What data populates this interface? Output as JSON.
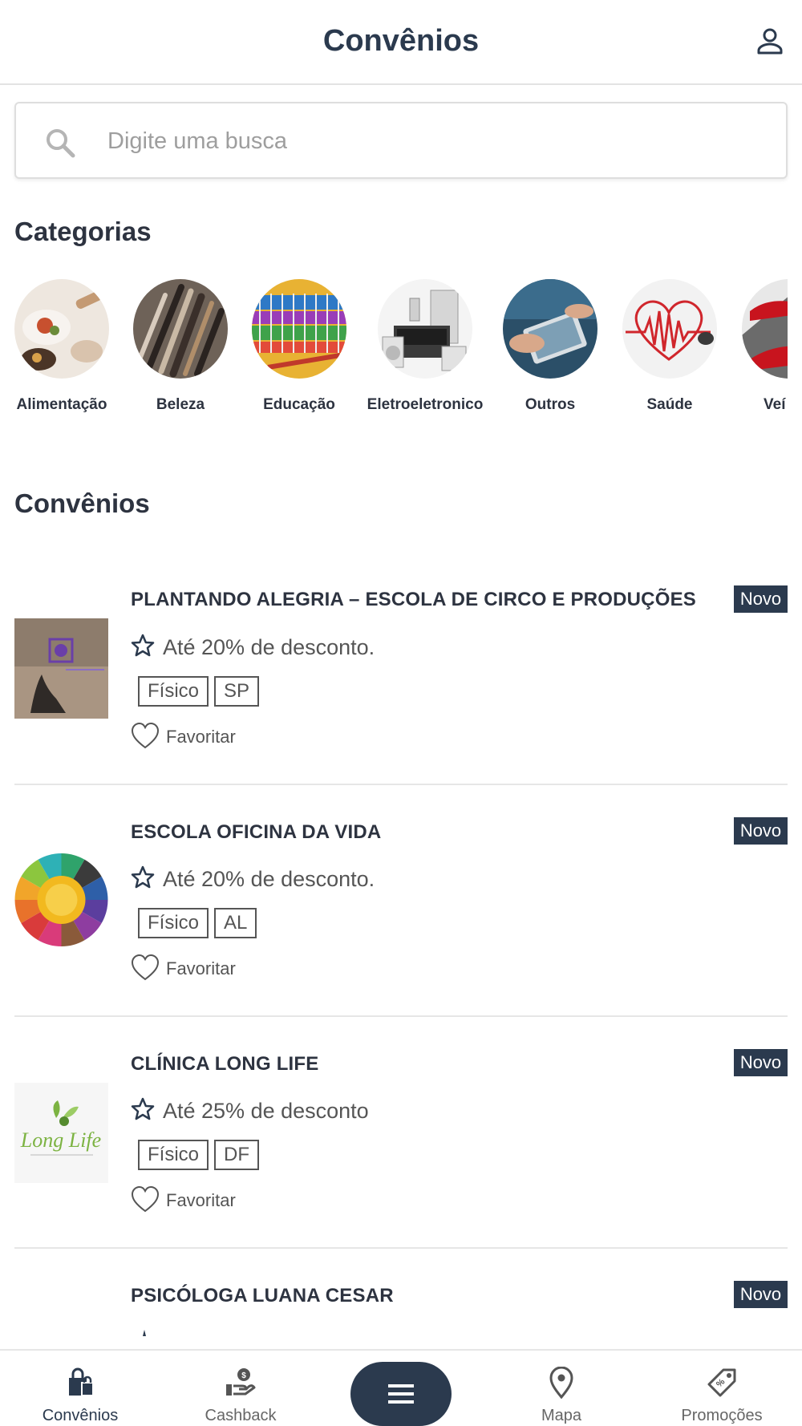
{
  "header": {
    "title": "Convênios",
    "profile_icon": "user-icon"
  },
  "search": {
    "placeholder": "Digite uma busca",
    "value": ""
  },
  "categories": {
    "title": "Categorias",
    "items": [
      {
        "label": "Alimentação",
        "color": "#c9a277"
      },
      {
        "label": "Beleza",
        "color": "#5a4a3a"
      },
      {
        "label": "Educação",
        "color": "#e0a830"
      },
      {
        "label": "Eletroeletronico",
        "color": "#bdbdbd"
      },
      {
        "label": "Outros",
        "color": "#2f5a78"
      },
      {
        "label": "Saúde",
        "color": "#cc2a2a"
      },
      {
        "label": "Veí",
        "color": "#b5141e"
      }
    ]
  },
  "convenios": {
    "title": "Convênios",
    "items": [
      {
        "title": "PLANTANDO ALEGRIA – ESCOLA DE CIRCO E PRODUÇÕES",
        "badge": "Novo",
        "discount": "Até 20% de desconto.",
        "tags": [
          "Físico",
          "SP"
        ],
        "favorite_label": "Favoritar"
      },
      {
        "title": "ESCOLA OFICINA DA VIDA",
        "badge": "Novo",
        "discount": "Até 20% de desconto.",
        "tags": [
          "Físico",
          "AL"
        ],
        "favorite_label": "Favoritar"
      },
      {
        "title": "CLÍNICA LONG LIFE",
        "badge": "Novo",
        "discount": "Até 25% de desconto",
        "tags": [
          "Físico",
          "DF"
        ],
        "favorite_label": "Favoritar",
        "logo_text": "Long Life"
      },
      {
        "title": "PSICÓLOGA LUANA CESAR",
        "badge": "Novo"
      }
    ]
  },
  "bottom_nav": {
    "items": [
      {
        "label": "Convênios",
        "icon": "shopping-bag-icon",
        "active": true
      },
      {
        "label": "Cashback",
        "icon": "cashback-hand-icon",
        "active": false
      },
      {
        "label": "",
        "icon": "menu-icon",
        "active": false
      },
      {
        "label": "Mapa",
        "icon": "map-pin-icon",
        "active": false
      },
      {
        "label": "Promoções",
        "icon": "tag-icon",
        "active": false
      }
    ]
  },
  "colors": {
    "primary": "#2b3a4e",
    "text": "#2d3340",
    "muted": "#555555",
    "divider": "#e6e6e6"
  }
}
